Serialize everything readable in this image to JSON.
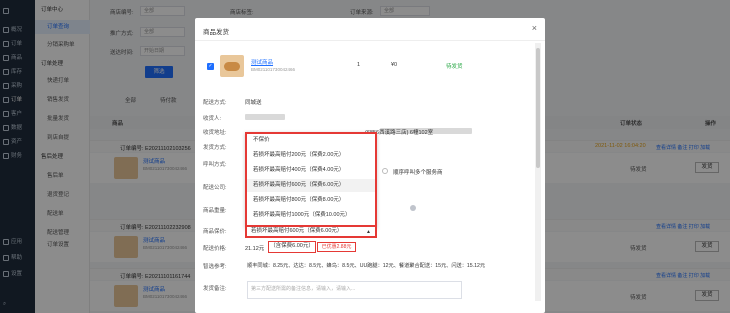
{
  "sidebar_dark": {
    "items": [
      "概况",
      "订单",
      "商品",
      "库存",
      "采购",
      "订单",
      "客户",
      "数据",
      "资产",
      "财务"
    ],
    "bottom": [
      "应用",
      "帮助",
      "设置"
    ]
  },
  "sidebar_light": {
    "items": [
      {
        "label": "订单中心",
        "group": true
      },
      {
        "label": "订单查询",
        "active": true
      },
      {
        "label": "分销采购单"
      },
      {
        "label": "订单处理",
        "group": true
      },
      {
        "label": "快递打单"
      },
      {
        "label": "销售发货"
      },
      {
        "label": "批量发货"
      },
      {
        "label": "到店自提"
      },
      {
        "label": "售后处理",
        "group": true
      },
      {
        "label": "售后单"
      },
      {
        "label": "退货登记"
      },
      {
        "label": "配送单"
      },
      {
        "label": "配送管理"
      },
      {
        "label": "订单设置"
      }
    ]
  },
  "background": {
    "filters": [
      {
        "label": "商店编号:",
        "value": "全部"
      },
      {
        "label": "商店标签:",
        "value": "全部"
      },
      {
        "label": "订单来源:",
        "value": "全部"
      },
      {
        "label": "推广方式:",
        "value": "全部"
      },
      {
        "label": "送达时间:",
        "value": "开始日期"
      }
    ],
    "search_btn": "筛选",
    "tabs": [
      "全部",
      "待付款"
    ],
    "headers": {
      "product": "商品",
      "status": "订单状态",
      "action": "操作"
    },
    "orders": [
      {
        "id": "订单编号: E20211102103256",
        "name": "测试商品",
        "sku": "BM021101730042466",
        "status": "待发货",
        "ops": "查看详情  备注  打印  加载"
      },
      {
        "id": "订单编号: E20211102232908",
        "name": "测试商品",
        "sku": "BM021101730042466",
        "status": "待发货",
        "ops": "查看详情  备注  打印  加载"
      },
      {
        "id": "订单编号: E20211101161744",
        "name": "测试商品",
        "sku": "BM021101730042466",
        "status": "待发货",
        "ops": "查看详情  备注  打印  加载"
      }
    ],
    "ship_btn": "发货",
    "time_tag": "2021-11-02 16:04:20"
  },
  "modal": {
    "title": "商品发货",
    "close": "×",
    "product": {
      "name": "测试商品",
      "sku": "BM021101730042466",
      "qty": "1",
      "price": "¥0",
      "status": "待发货"
    },
    "delivery_method_label": "配送方式:",
    "delivery_method": "同城送",
    "receiver_label": "收货人:",
    "address_label": "收货地址:",
    "address_tail": "(6856西溪路三店) 6幢102室",
    "ship_method_label": "发货方式:",
    "call_method_label": "呼叫方式:",
    "call_option": "顺序呼叫多个服务商",
    "company_label": "配送公司:",
    "weight_label": "商品重量:",
    "insure_label": "商品保价:",
    "insure_options": [
      "不保价",
      "若损坏最高赔付200元（保费2.00元）",
      "若损坏最高赔付400元（保费4.00元）",
      "若损坏最高赔付600元（保费6.00元）",
      "若损坏最高赔付800元（保费8.00元）",
      "若损坏最高赔付1000元（保费10.00元）"
    ],
    "insure_selected": "若损坏最高赔付600元（保费6.00元）",
    "price_label": "配送价格:",
    "price_value": "21.12元",
    "price_insure": "（含保费6.00元）",
    "discount": "已优惠2.88元",
    "ref_label": "智选参考:",
    "ref_value": "顺丰同城：8.25元、达达：8.5元、蜂鸟：8.5元、UU跑腿：12元、餐道聚合配送：15元、闪送：15.12元",
    "remark_label": "发货备注:",
    "remark_placeholder": "第三方配送所需的备注信息，请输入，请输入..."
  }
}
